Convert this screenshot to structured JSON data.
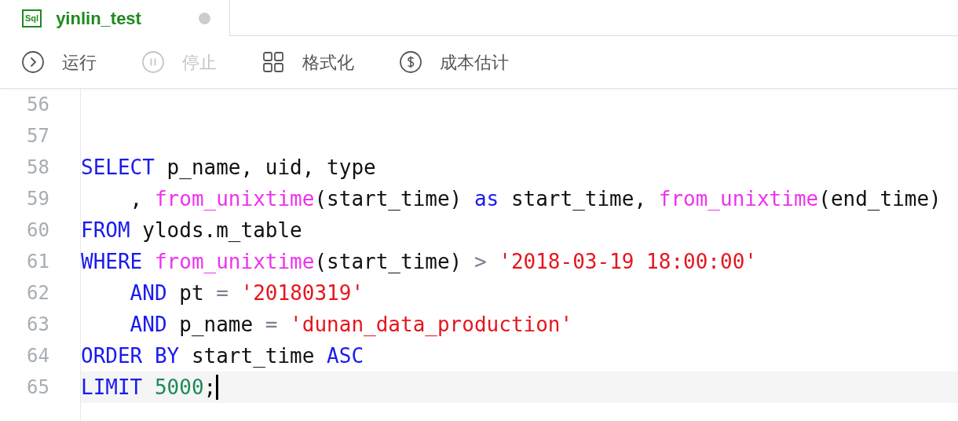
{
  "tab": {
    "icon_text": "Sql",
    "title": "yinlin_test",
    "selected": true,
    "unsaved": true
  },
  "toolbar": [
    {
      "kind": "run",
      "label": "运行",
      "disabled": false
    },
    {
      "kind": "stop",
      "label": "停止",
      "disabled": true
    },
    {
      "kind": "format",
      "label": "格式化",
      "disabled": false
    },
    {
      "kind": "cost",
      "label": "成本估计",
      "disabled": false
    }
  ],
  "editor": {
    "lines": [
      {
        "number": "56",
        "active": false
      },
      {
        "number": "57",
        "active": false
      },
      {
        "number": "58",
        "active": false,
        "tokens": [
          {
            "kind": "keyword",
            "text": "SELECT"
          },
          {
            "kind": "plain",
            "text": " p_name, uid, type"
          }
        ]
      },
      {
        "number": "59",
        "active": false,
        "tokens": [
          {
            "kind": "plain",
            "text": "    , "
          },
          {
            "kind": "function",
            "text": "from_unixtime"
          },
          {
            "kind": "plain",
            "text": "(start_time) "
          },
          {
            "kind": "keyword",
            "text": "as"
          },
          {
            "kind": "plain",
            "text": " start_time, "
          },
          {
            "kind": "function",
            "text": "from_unixtime"
          },
          {
            "kind": "plain",
            "text": "(end_time)"
          }
        ]
      },
      {
        "number": "60",
        "active": false,
        "tokens": [
          {
            "kind": "keyword",
            "text": "FROM"
          },
          {
            "kind": "plain",
            "text": " ylods.m_table"
          }
        ]
      },
      {
        "number": "61",
        "active": false,
        "tokens": [
          {
            "kind": "keyword",
            "text": "WHERE"
          },
          {
            "kind": "function",
            "text": " from_unixtime"
          },
          {
            "kind": "plain",
            "text": "(start_time)"
          },
          {
            "kind": "operator",
            "text": " >"
          },
          {
            "kind": "string",
            "text": " '2018-03-19 18:00:00'"
          }
        ]
      },
      {
        "number": "62",
        "active": false,
        "tokens": [
          {
            "kind": "keyword",
            "text": "    AND"
          },
          {
            "kind": "plain",
            "text": " pt"
          },
          {
            "kind": "operator",
            "text": " ="
          },
          {
            "kind": "string",
            "text": " '20180319'"
          }
        ]
      },
      {
        "number": "63",
        "active": false,
        "tokens": [
          {
            "kind": "keyword",
            "text": "    AND"
          },
          {
            "kind": "plain",
            "text": " p_name"
          },
          {
            "kind": "operator",
            "text": " ="
          },
          {
            "kind": "string",
            "text": " 'dunan_data_production'"
          }
        ]
      },
      {
        "number": "64",
        "active": false,
        "tokens": [
          {
            "kind": "keyword",
            "text": "ORDER BY"
          },
          {
            "kind": "plain",
            "text": " start_time "
          },
          {
            "kind": "keyword",
            "text": "ASC"
          }
        ]
      },
      {
        "number": "65",
        "active": true,
        "tokens": [
          {
            "kind": "keyword",
            "text": "LIMIT"
          },
          {
            "kind": "number",
            "text": " 5000"
          },
          {
            "kind": "plain",
            "text": ";"
          }
        ]
      }
    ]
  }
}
